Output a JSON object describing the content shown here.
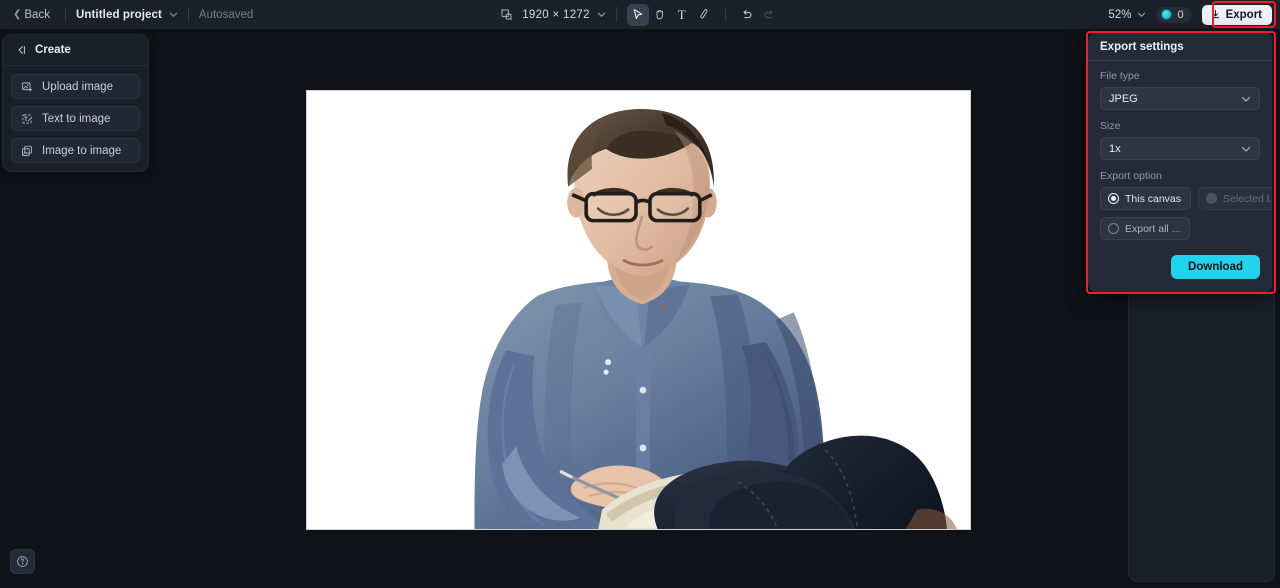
{
  "topbar": {
    "back_label": "Back",
    "project_name": "Untitled project",
    "autosaved_label": "Autosaved",
    "canvas_icon": "artboard-icon",
    "dimensions": "1920 × 1272",
    "tools": [
      {
        "name": "select-tool",
        "glyph": "select-cursor-icon",
        "active": true
      },
      {
        "name": "hand-tool",
        "glyph": "hand-icon",
        "active": false
      },
      {
        "name": "text-tool",
        "glyph": "text-T-icon",
        "label": "T",
        "active": false
      },
      {
        "name": "brush-tool",
        "glyph": "brush-icon",
        "active": false
      }
    ],
    "undo_label": "undo-icon",
    "redo_label": "redo-icon",
    "zoom_level": "52%",
    "credits_count": "0",
    "export_label": "Export"
  },
  "left_panel": {
    "header_title": "Create",
    "collapse_icon": "collapse-panel-icon",
    "items": [
      {
        "label": "Upload image",
        "icon": "upload-image-icon"
      },
      {
        "label": "Text to image",
        "icon": "text-to-image-icon"
      },
      {
        "label": "Image to image",
        "icon": "image-to-image-icon"
      }
    ]
  },
  "canvas": {
    "artboard_alt": "Young man with glasses in a blue chambray shirt and dark jeans, sitting cross-legged and writing on a notepad, on a white background"
  },
  "help": {
    "icon": "help-question-icon",
    "label": "Help"
  },
  "export_panel": {
    "title": "Export settings",
    "file_type_label": "File type",
    "file_type_value": "JPEG",
    "size_label": "Size",
    "size_value": "1x",
    "export_option_label": "Export option",
    "options": [
      {
        "label": "This canvas",
        "selected": true,
        "disabled": false
      },
      {
        "label": "Selected l...",
        "selected": false,
        "disabled": true
      },
      {
        "label": "Export all ...",
        "selected": false,
        "disabled": false
      }
    ],
    "download_label": "Download"
  },
  "colors": {
    "topbar_bg": "#1c2029",
    "canvas_bg": "#0f1217",
    "panel_bg": "#1b1f28",
    "popover_bg": "#252b36",
    "accent_cyan": "#22d3ee",
    "highlight_red": "#f51d2c",
    "export_btn_bg": "#eef1f6"
  }
}
